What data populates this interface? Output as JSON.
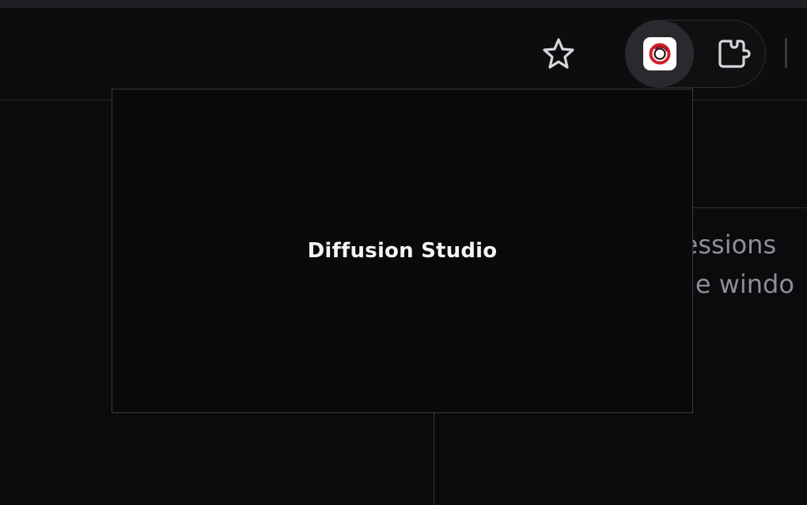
{
  "toolbar": {
    "bookmark_icon": "star-icon",
    "extension_active_icon": "diffusion-studio-logo-icon",
    "extensions_menu_icon": "puzzle-icon",
    "colors": {
      "background": "#0d0d10",
      "icon": "#d6d6da",
      "active_pill": "#2a2a2e",
      "logo_red": "#d11f2b"
    }
  },
  "page": {
    "background_text": {
      "line1": "sessions",
      "line2": "the windo"
    }
  },
  "popup": {
    "title": "Diffusion Studio"
  }
}
